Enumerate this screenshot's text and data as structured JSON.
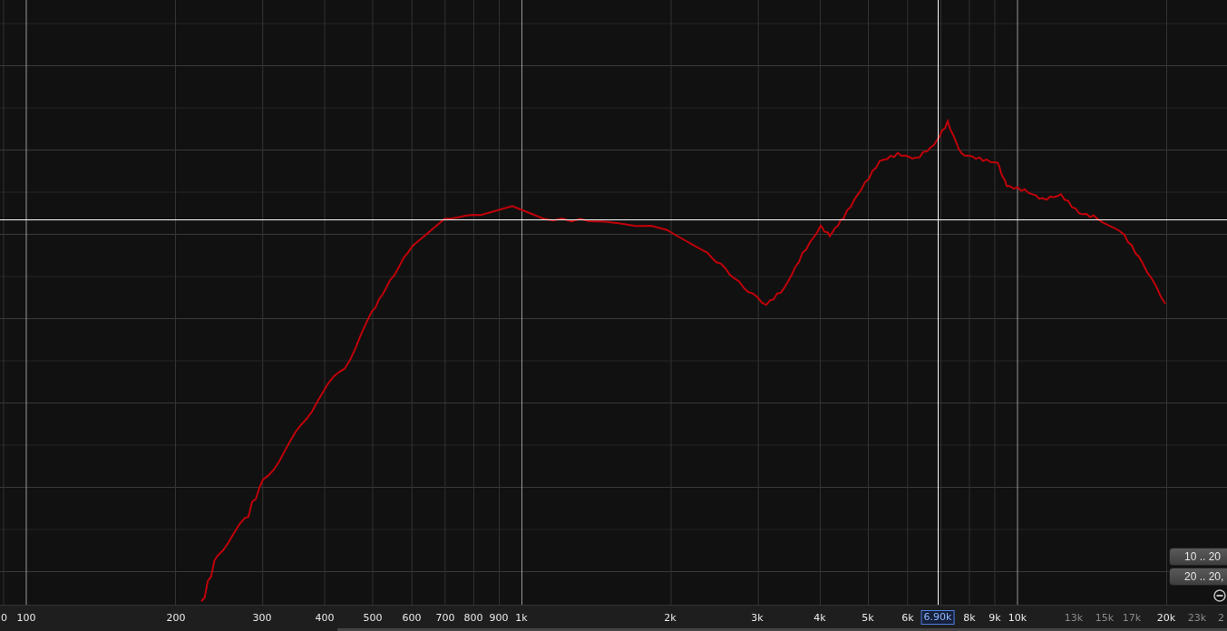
{
  "frequency_axis": {
    "labels": [
      {
        "text": "0",
        "kind": "major"
      },
      {
        "text": "100",
        "kind": "major"
      },
      {
        "text": "200",
        "kind": "major"
      },
      {
        "text": "300",
        "kind": "major"
      },
      {
        "text": "400",
        "kind": "major"
      },
      {
        "text": "500",
        "kind": "major"
      },
      {
        "text": "600",
        "kind": "major"
      },
      {
        "text": "700",
        "kind": "major"
      },
      {
        "text": "800",
        "kind": "major"
      },
      {
        "text": "900",
        "kind": "major"
      },
      {
        "text": "1k",
        "kind": "major"
      },
      {
        "text": "2k",
        "kind": "major"
      },
      {
        "text": "3k",
        "kind": "major"
      },
      {
        "text": "4k",
        "kind": "major"
      },
      {
        "text": "5k",
        "kind": "major"
      },
      {
        "text": "6k",
        "kind": "major"
      },
      {
        "text": "6.90k",
        "kind": "cursor"
      },
      {
        "text": "8k",
        "kind": "major"
      },
      {
        "text": "9k",
        "kind": "major"
      },
      {
        "text": "10k",
        "kind": "major"
      },
      {
        "text": "13k",
        "kind": "minor"
      },
      {
        "text": "15k",
        "kind": "minor"
      },
      {
        "text": "17k",
        "kind": "minor"
      },
      {
        "text": "20k",
        "kind": "major"
      },
      {
        "text": "23k",
        "kind": "minor"
      },
      {
        "text": "2",
        "kind": "minor"
      }
    ]
  },
  "range_buttons": [
    "10 .. 20",
    "20 .. 20,"
  ]
}
